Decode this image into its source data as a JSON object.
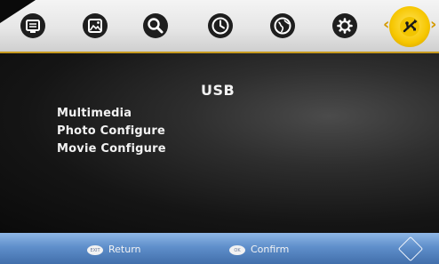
{
  "topbar": {
    "icons": [
      {
        "name": "channel-icon"
      },
      {
        "name": "picture-icon"
      },
      {
        "name": "search-icon"
      },
      {
        "name": "clock-icon"
      },
      {
        "name": "globe-icon"
      },
      {
        "name": "gear-icon"
      },
      {
        "name": "usb-icon",
        "selected": true
      }
    ],
    "left_arrow": "‹",
    "right_arrow": "›"
  },
  "main": {
    "title": "USB",
    "items": [
      {
        "label": "Multimedia"
      },
      {
        "label": "Photo Configure"
      },
      {
        "label": "Movie Configure"
      }
    ]
  },
  "footer": {
    "return": {
      "key": "EXIT",
      "label": "Return"
    },
    "confirm": {
      "key": "OK",
      "label": "Confirm"
    }
  },
  "colors": {
    "accent": "#c79a1f",
    "selected_icon_bg": "#f6c600",
    "footer_bg": "#5f8fcb",
    "icon_dark": "#1e1e1e"
  }
}
